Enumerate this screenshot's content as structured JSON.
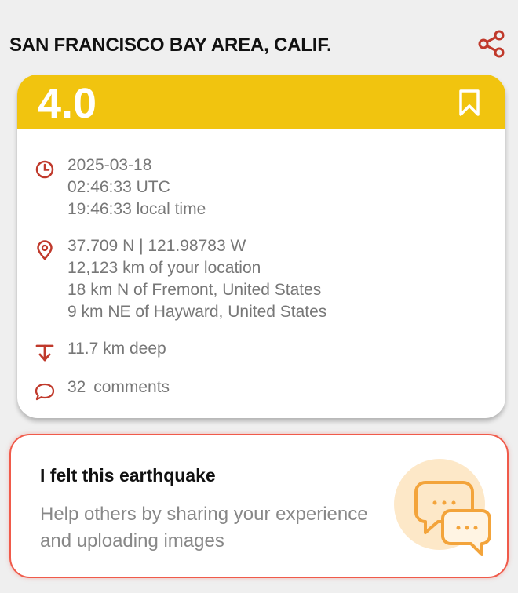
{
  "header": {
    "title": "SAN FRANCISCO BAY AREA, CALIF.",
    "share_icon": "share-icon"
  },
  "quake": {
    "magnitude": "4.0",
    "bookmark_icon": "bookmark-icon",
    "time": {
      "date": "2025-03-18",
      "utc": "02:46:33 UTC",
      "local": "19:46:33 local time"
    },
    "location": {
      "coords": "37.709 N | 121.98783 W",
      "distance": "12,123 km of your location",
      "near1": "18 km N of Fremont, United States",
      "near2": "9 km NE of Hayward, United States"
    },
    "depth": "11.7 km deep",
    "comments_count": "32",
    "comments_label": "comments"
  },
  "felt": {
    "title": "I felt this earthquake",
    "subtitle": "Help others by sharing your experience and uploading images"
  },
  "colors": {
    "accent_yellow": "#f1c40f",
    "accent_red": "#c0392b",
    "felt_border": "#f05a4a",
    "art_orange": "#f3a43b"
  }
}
